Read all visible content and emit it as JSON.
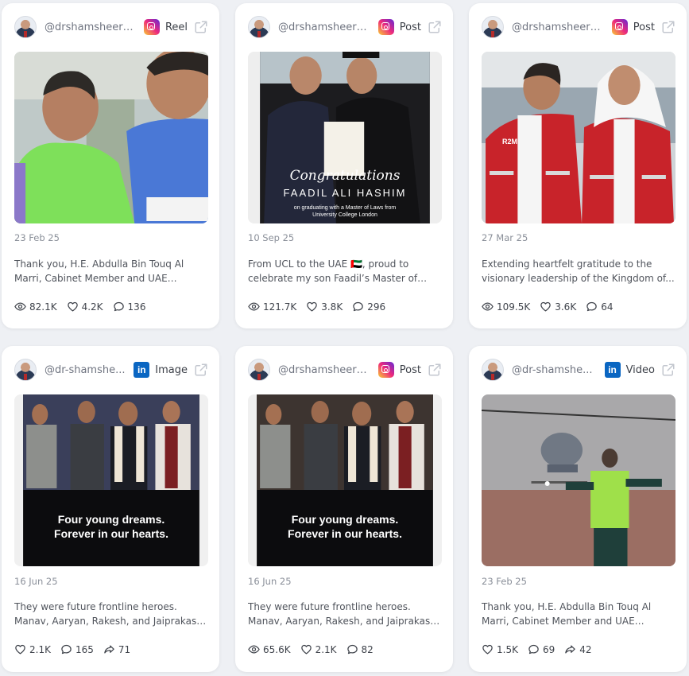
{
  "cards": [
    {
      "handle": "@drshamsheervp",
      "platform": "instagram",
      "platform_icon": "instagram-icon",
      "type": "Reel",
      "date": "23 Feb 25",
      "caption": "Thank you, H.E. Abdulla Bin Touq Al Marri, Cabinet Member and UAE Minister of...",
      "stats": {
        "views": "82.1K",
        "likes": "4.2K",
        "comments": "136"
      }
    },
    {
      "handle": "@drshamsheervp",
      "platform": "instagram",
      "platform_icon": "instagram-icon",
      "type": "Post",
      "date": "10 Sep 25",
      "caption": "From UCL to the UAE 🇦🇪, proud to celebrate my son Faadil’s Master of Law...",
      "image_text": {
        "script": "Congratulations",
        "name": "FAADIL ALI HASHIM",
        "line1": "on graduating with a Master of Laws from",
        "line2": "University College London"
      },
      "stats": {
        "views": "121.7K",
        "likes": "3.8K",
        "comments": "296"
      }
    },
    {
      "handle": "@drshamsheervp",
      "platform": "instagram",
      "platform_icon": "instagram-icon",
      "type": "Post",
      "date": "27 Mar 25",
      "caption": "Extending heartfelt gratitude to the visionary leadership of the Kingdom of...",
      "image_text": {
        "vest": "R2M"
      },
      "stats": {
        "views": "109.5K",
        "likes": "3.6K",
        "comments": "64"
      }
    },
    {
      "handle": "@dr-shamshe...",
      "platform": "linkedin",
      "platform_icon": "linkedin-icon",
      "platform_letters": "in",
      "type": "Image",
      "date": "16 Jun 25",
      "caption": "They were future frontline heroes. Manav, Aaryan, Rakesh, and Jaiprakash were...",
      "image_text": {
        "line1": "Four young dreams.",
        "line2": "Forever in our hearts."
      },
      "stats": {
        "likes": "2.1K",
        "comments": "165",
        "shares": "71"
      }
    },
    {
      "handle": "@drshamsheervp",
      "platform": "instagram",
      "platform_icon": "instagram-icon",
      "type": "Post",
      "date": "16 Jun 25",
      "caption": "They were future frontline heroes. Manav, Aaryan, Rakesh, and Jaiprakash were...",
      "image_text": {
        "line1": "Four young dreams.",
        "line2": "Forever in our hearts."
      },
      "stats": {
        "views": "65.6K",
        "likes": "2.1K",
        "comments": "82"
      }
    },
    {
      "handle": "@dr-shamshe...",
      "platform": "linkedin",
      "platform_icon": "linkedin-icon",
      "platform_letters": "in",
      "type": "Video",
      "date": "23 Feb 25",
      "caption": "Thank you, H.E. Abdulla Bin Touq Al Marri, Cabinet Member and UAE Minister of...",
      "stats": {
        "likes": "1.5K",
        "comments": "69",
        "shares": "42"
      }
    }
  ],
  "colors": {
    "accent_instagram": "#ee2a7b",
    "accent_linkedin": "#0a66c2",
    "card_bg": "#ffffff",
    "page_bg": "#eef0f4"
  }
}
